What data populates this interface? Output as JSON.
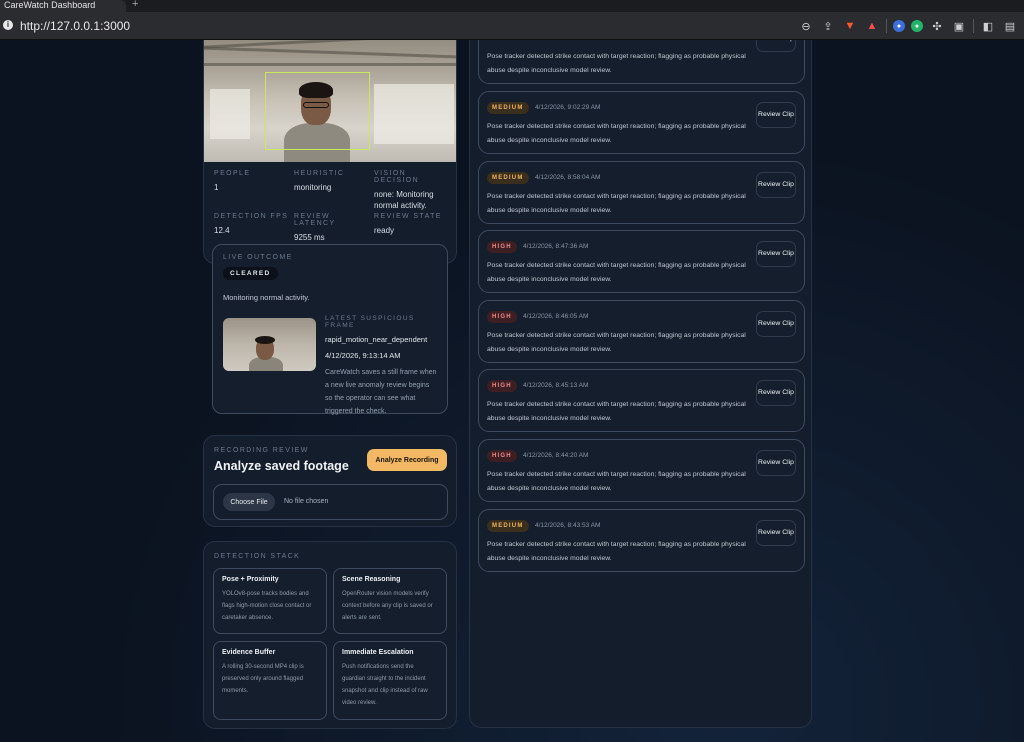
{
  "browser": {
    "tab_title": "CareWatch Dashboard",
    "url": "http://127.0.0.1:3000"
  },
  "camera": {
    "stats": [
      {
        "label": "PEOPLE",
        "value": "1"
      },
      {
        "label": "HEURISTIC",
        "value": "monitoring"
      },
      {
        "label": "VISION DECISION",
        "value": "none: Monitoring normal activity."
      },
      {
        "label": "DETECTION FPS",
        "value": "12.4"
      },
      {
        "label": "REVIEW LATENCY",
        "value": "9255 ms"
      },
      {
        "label": "REVIEW STATE",
        "value": "ready"
      }
    ]
  },
  "outcome": {
    "label": "LIVE OUTCOME",
    "badge": "CLEARED",
    "text": "Monitoring normal activity.",
    "frame_label": "LATEST SUSPICIOUS FRAME",
    "frame_reason": "rapid_motion_near_dependent",
    "frame_time": "4/12/2026, 9:13:14 AM",
    "frame_desc": "CareWatch saves a still frame when a new live anomaly review begins so the operator can see what triggered the check."
  },
  "recording": {
    "label": "RECORDING REVIEW",
    "title": "Analyze saved footage",
    "analyze_button": "Analyze Recording",
    "choose_button": "Choose File",
    "no_file": "No file chosen"
  },
  "stack": {
    "label": "DETECTION STACK",
    "cards": [
      {
        "title": "Pose + Proximity",
        "desc": "YOLOv8-pose tracks bodies and flags high-motion close contact or caretaker absence."
      },
      {
        "title": "Scene Reasoning",
        "desc": "OpenRouter vision models verify context before any clip is saved or alerts are sent."
      },
      {
        "title": "Evidence Buffer",
        "desc": "A rolling 30-second MP4 clip is preserved only around flagged moments."
      },
      {
        "title": "Immediate Escalation",
        "desc": "Push notifications send the guardian straight to the incident snapshot and clip instead of raw video review."
      }
    ]
  },
  "events": [
    {
      "severity": "",
      "time": "",
      "desc": "Pose tracker detected strike contact with target reaction; flagging as probable physical abuse despite inconclusive model review.",
      "button": "Review Clip"
    },
    {
      "severity": "MEDIUM",
      "time": "4/12/2026, 9:02:29 AM",
      "desc": "Pose tracker detected strike contact with target reaction; flagging as probable physical abuse despite inconclusive model review.",
      "button": "Review Clip"
    },
    {
      "severity": "MEDIUM",
      "time": "4/12/2026, 8:58:04 AM",
      "desc": "Pose tracker detected strike contact with target reaction; flagging as probable physical abuse despite inconclusive model review.",
      "button": "Review Clip"
    },
    {
      "severity": "HIGH",
      "time": "4/12/2026, 8:47:36 AM",
      "desc": "Pose tracker detected strike contact with target reaction; flagging as probable physical abuse despite inconclusive model review.",
      "button": "Review Clip"
    },
    {
      "severity": "HIGH",
      "time": "4/12/2026, 8:46:05 AM",
      "desc": "Pose tracker detected strike contact with target reaction; flagging as probable physical abuse despite inconclusive model review.",
      "button": "Review Clip"
    },
    {
      "severity": "HIGH",
      "time": "4/12/2026, 8:45:13 AM",
      "desc": "Pose tracker detected strike contact with target reaction; flagging as probable physical abuse despite inconclusive model review.",
      "button": "Review Clip"
    },
    {
      "severity": "HIGH",
      "time": "4/12/2026, 8:44:20 AM",
      "desc": "Pose tracker detected strike contact with target reaction; flagging as probable physical abuse despite inconclusive model review.",
      "button": "Review Clip"
    },
    {
      "severity": "MEDIUM",
      "time": "4/12/2026, 8:43:53 AM",
      "desc": "Pose tracker detected strike contact with target reaction; flagging as probable physical abuse despite inconclusive model review.",
      "button": "Review Clip"
    }
  ],
  "colors": {
    "accent_button": "#f3b864",
    "medium": "#f0b45e",
    "high": "#f08a8a",
    "face_box": "#c9e85a"
  }
}
